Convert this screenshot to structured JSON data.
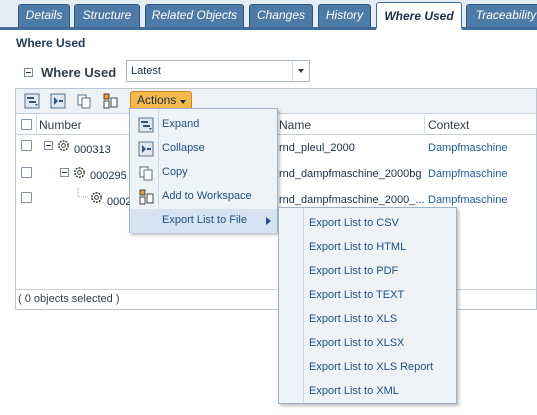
{
  "tabs": [
    {
      "label": "Details",
      "active": false
    },
    {
      "label": "Structure",
      "active": false
    },
    {
      "label": "Related Objects",
      "active": false
    },
    {
      "label": "Changes",
      "active": false
    },
    {
      "label": "History",
      "active": false
    },
    {
      "label": "Where Used",
      "active": true
    },
    {
      "label": "Traceability",
      "active": false
    }
  ],
  "page": {
    "title": "Where Used"
  },
  "where_used": {
    "label": "Where Used",
    "filter_value": "Latest"
  },
  "toolbar": {
    "actions_label": "Actions"
  },
  "table": {
    "columns": {
      "number": "Number",
      "name": "Name",
      "context": "Context"
    },
    "rows": [
      {
        "number": "000313",
        "name": "rnd_pleul_2000",
        "context": "Dampfmaschine"
      },
      {
        "number": "000295",
        "name": "rnd_dampfmaschine_2000bg",
        "context": "Dampfmaschine"
      },
      {
        "number": "0002",
        "name": "rnd_dampfmaschine_2000_...",
        "context": "Dampfmaschine"
      }
    ],
    "footer": "( 0 objects selected )"
  },
  "actions_menu": {
    "items": [
      {
        "label": "Expand",
        "icon": "expand-icon"
      },
      {
        "label": "Collapse",
        "icon": "collapse-icon"
      },
      {
        "label": "Copy",
        "icon": "copy-icon"
      },
      {
        "label": "Add to Workspace",
        "icon": "workspace-icon"
      },
      {
        "label": "Export List to File",
        "icon": "submenu-arrow"
      }
    ]
  },
  "export_menu": {
    "items": [
      "Export List to CSV",
      "Export List to HTML",
      "Export List to PDF",
      "Export List to TEXT",
      "Export List to XLS",
      "Export List to XLSX",
      "Export List to XLS Report",
      "Export List to XML"
    ]
  },
  "colors": {
    "tab": "#4d7aa6",
    "accent": "#3f6d99",
    "actions_button": "#f5b94a",
    "link": "#1f5fa0"
  }
}
